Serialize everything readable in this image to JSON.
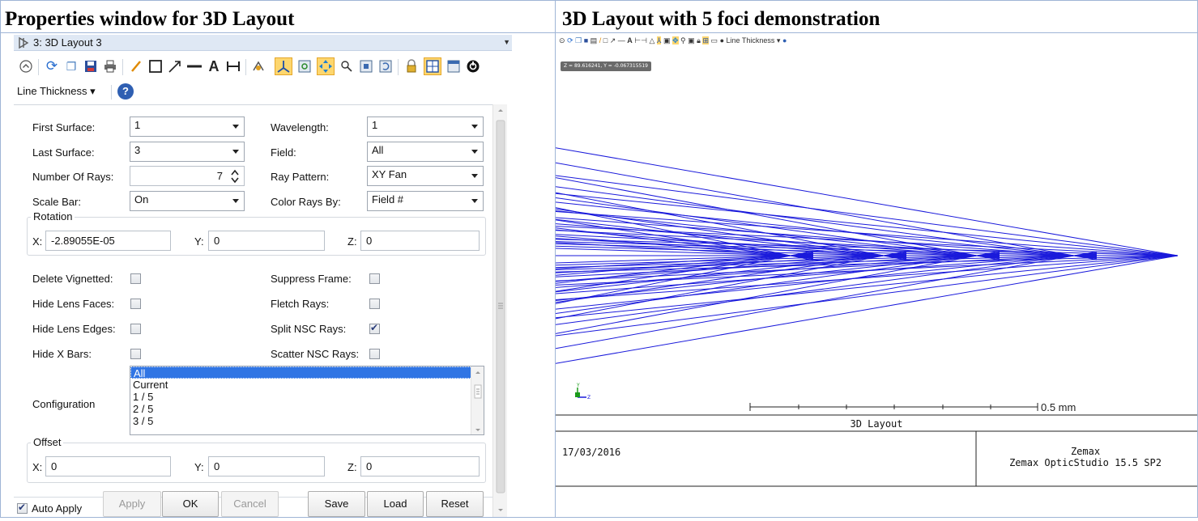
{
  "captions": {
    "left": "Properties window for 3D Layout",
    "right": "3D Layout with 5 foci demonstration"
  },
  "window": {
    "title": "3: 3D Layout 3",
    "line_thickness": "Line Thickness ▾",
    "help": "?"
  },
  "fields": {
    "first_surface": {
      "label": "First Surface:",
      "value": "1"
    },
    "last_surface": {
      "label": "Last Surface:",
      "value": "3"
    },
    "num_rays": {
      "label": "Number Of Rays:",
      "value": "7"
    },
    "scale_bar": {
      "label": "Scale Bar:",
      "value": "On"
    },
    "wavelength": {
      "label": "Wavelength:",
      "value": "1"
    },
    "field": {
      "label": "Field:",
      "value": "All"
    },
    "ray_pattern": {
      "label": "Ray Pattern:",
      "value": "XY Fan"
    },
    "color_rays_by": {
      "label": "Color Rays By:",
      "value": "Field #"
    }
  },
  "rotation": {
    "title": "Rotation",
    "x_label": "X:",
    "x": "-2.89055E-05",
    "y_label": "Y:",
    "y": "0",
    "z_label": "Z:",
    "z": "0"
  },
  "checks": {
    "delete_vignetted": {
      "label": "Delete Vignetted:",
      "checked": false
    },
    "hide_lens_faces": {
      "label": "Hide Lens Faces:",
      "checked": false
    },
    "hide_lens_edges": {
      "label": "Hide Lens Edges:",
      "checked": false
    },
    "hide_x_bars": {
      "label": "Hide X Bars:",
      "checked": false
    },
    "suppress_frame": {
      "label": "Suppress Frame:",
      "checked": false
    },
    "fletch_rays": {
      "label": "Fletch Rays:",
      "checked": false
    },
    "split_nsc_rays": {
      "label": "Split NSC Rays:",
      "checked": true
    },
    "scatter_nsc_rays": {
      "label": "Scatter NSC Rays:",
      "checked": false
    }
  },
  "configuration": {
    "label": "Configuration",
    "items": [
      "All",
      "Current",
      "1 / 5",
      "2 / 5",
      "3 / 5"
    ],
    "selected": "All"
  },
  "offset": {
    "title": "Offset",
    "x_label": "X:",
    "x": "0",
    "y_label": "Y:",
    "y": "0",
    "z_label": "Z:",
    "z": "0"
  },
  "buttons": {
    "auto_apply": "Auto Apply",
    "apply": "Apply",
    "ok": "OK",
    "cancel": "Cancel",
    "save": "Save",
    "load": "Load",
    "reset": "Reset"
  },
  "plot": {
    "toolbar_label": "Line Thickness ▾",
    "coord_readout": "Z = 89.616241, Y = -0.067315519",
    "scale_label": "0.5 mm",
    "plot_title": "3D Layout",
    "date": "17/03/2016",
    "company": "Zemax",
    "product": "Zemax OpticStudio 15.5 SP2",
    "axis_y": "Y",
    "axis_z": "Z",
    "ray_color": "#1a1adb"
  }
}
